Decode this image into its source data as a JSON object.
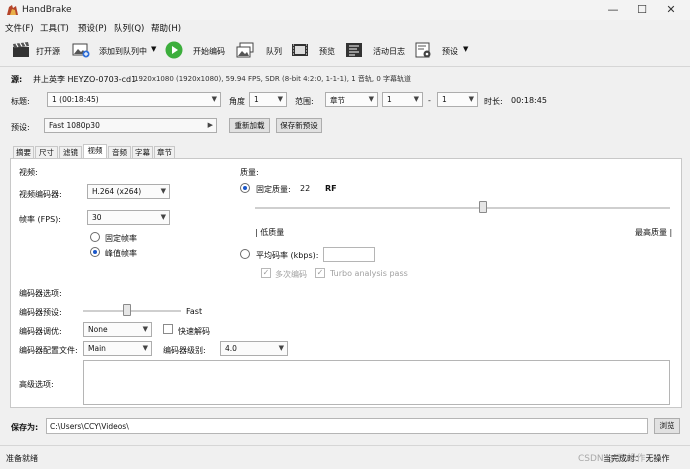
{
  "window": {
    "title": "HandBrake",
    "controls": {
      "minimize": "—",
      "maximize": "☐",
      "close": "✕"
    }
  },
  "menu": [
    "文件(F)",
    "工具(T)",
    "预设(P)",
    "队列(Q)",
    "帮助(H)"
  ],
  "toolbar": {
    "open_source": "打开源",
    "add_to_queue": "添加到队列中",
    "start_encode": "开始编码",
    "queue": "队列",
    "preview": "预览",
    "activity_log": "活动日志",
    "presets": "预设"
  },
  "source": {
    "label": "源:",
    "name": "井上英李 HEYZO-0703-cd1",
    "info": "1920x1080 (1920x1080), 59.94 FPS, SDR (8-bit 4:2:0, 1-1-1), 1 音轨, 0 字幕轨道"
  },
  "title_row": {
    "title_label": "标题:",
    "title_value": "1 (00:18:45)",
    "angle_label": "角度",
    "angle_value": "1",
    "range_label": "范围:",
    "range_type": "章节",
    "range_start": "1",
    "range_dash": "-",
    "range_end": "1",
    "duration_label": "时长:",
    "duration_value": "00:18:45"
  },
  "preset_row": {
    "label": "预设:",
    "value": "Fast 1080p30",
    "reload_button": "重新加载",
    "save_button": "保存新预设"
  },
  "tabs": [
    "摘要",
    "尺寸",
    "滤镜",
    "视频",
    "音频",
    "字幕",
    "章节"
  ],
  "active_tab": "视频",
  "video": {
    "section": "视频:",
    "encoder_label": "视频编码器:",
    "encoder_value": "H.264 (x264)",
    "framerate_label": "帧率 (FPS):",
    "framerate_value": "30",
    "constant_fr": "固定帧率",
    "peak_fr": "峰值帧率",
    "peak_selected": true
  },
  "quality": {
    "section": "质量:",
    "constant_quality": "固定质量:",
    "cq_value": "22",
    "cq_unit": "RF",
    "slider_fraction": 0.55,
    "low_quality": "| 低质量",
    "high_quality": "最高质量 |",
    "avg_bitrate": "平均码率 (kbps):",
    "avg_bitrate_value": "",
    "multi_pass": "多次编码",
    "turbo": "Turbo analysis pass"
  },
  "encoder_options": {
    "section": "编码器选项:",
    "preset_label": "编码器预设:",
    "preset_value": "Fast",
    "preset_slider_fraction": 0.45,
    "tune_label": "编码器调优:",
    "tune_value": "None",
    "fast_decode": "快速解码",
    "profile_label": "编码器配置文件:",
    "profile_value": "Main",
    "level_label": "编码器级别:",
    "level_value": "4.0",
    "advanced_label": "高级选项:",
    "advanced_value": ""
  },
  "save": {
    "label": "保存为:",
    "path": "C:\\Users\\CCY\\Videos\\",
    "browse": "浏览"
  },
  "status": {
    "text": "准备就绪",
    "when_done": "当完成时：  无操作",
    "watermark": "CSDN @无 操作"
  },
  "colors": {
    "accent": "#1a57c9",
    "play_green": "#3cae3c"
  }
}
